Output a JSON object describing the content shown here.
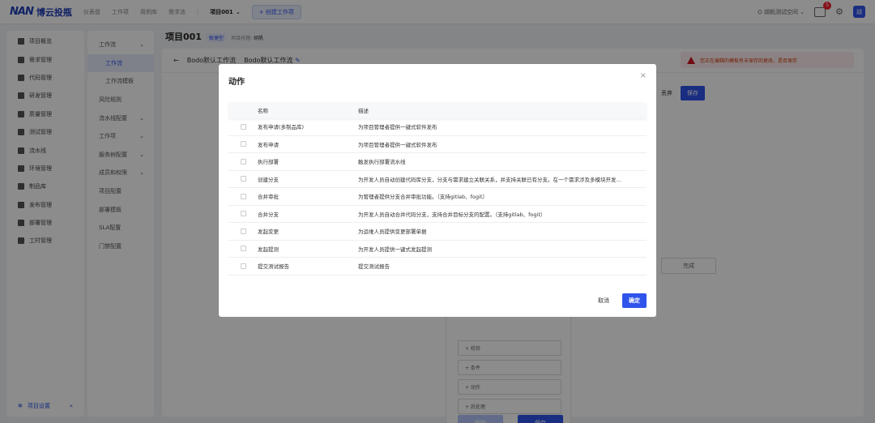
{
  "header": {
    "logo_mark": "NAN",
    "logo_text": "博云投瓶",
    "nav": [
      "仪表盘",
      "工作项",
      "用例库",
      "需求池"
    ],
    "project_select": "项目001",
    "create_button": "+ 创建工作项",
    "workspace": "胡帆测试空间",
    "notif_count": "5",
    "avatar": "胡"
  },
  "sidebar": {
    "items": [
      {
        "label": "项目概览",
        "icon": "home-icon"
      },
      {
        "label": "需求管理",
        "icon": "grid-icon"
      },
      {
        "label": "代码管理",
        "icon": "code-icon"
      },
      {
        "label": "研发管理",
        "icon": "dev-icon"
      },
      {
        "label": "质量管理",
        "icon": "quality-icon"
      },
      {
        "label": "测试管理",
        "icon": "test-icon"
      },
      {
        "label": "流水线",
        "icon": "pipeline-icon"
      },
      {
        "label": "环境管理",
        "icon": "env-icon"
      },
      {
        "label": "制品库",
        "icon": "artifact-icon"
      },
      {
        "label": "发布管理",
        "icon": "release-icon"
      },
      {
        "label": "部署管理",
        "icon": "deploy-icon"
      },
      {
        "label": "工时管理",
        "icon": "timesheet-icon"
      }
    ],
    "footer_label": "项目设置",
    "collapse": "«"
  },
  "subnav": {
    "items": [
      {
        "label": "工作流",
        "chev": "⌄",
        "kind": "group"
      },
      {
        "label": "工作流",
        "chev": "",
        "kind": "active"
      },
      {
        "label": "工作流模板",
        "chev": "",
        "kind": "child"
      },
      {
        "label": "风险规则",
        "chev": "",
        "kind": "group"
      },
      {
        "label": "流水线配置",
        "chev": "⌄",
        "kind": "group"
      },
      {
        "label": "工作项",
        "chev": "⌄",
        "kind": "group"
      },
      {
        "label": "服务树配置",
        "chev": "⌄",
        "kind": "group"
      },
      {
        "label": "成员和权限",
        "chev": "⌄",
        "kind": "group"
      },
      {
        "label": "项目配置",
        "chev": "",
        "kind": "group"
      },
      {
        "label": "部署模板",
        "chev": "",
        "kind": "group"
      },
      {
        "label": "SLA配置",
        "chev": "",
        "kind": "group"
      },
      {
        "label": "门禁配置",
        "chev": "",
        "kind": "group"
      }
    ]
  },
  "main": {
    "project_name": "项目001",
    "tag": "敏捷型",
    "manager_label": "项目经理:",
    "manager_name": "胡帆",
    "back_title": "Bodo默认工作流",
    "tab_title": "Bodo默认工作流",
    "warning": "您正在编辑的模板有未保存的更改，是否保存",
    "discard": "丢弃",
    "save": "保存",
    "done_node": "完成",
    "side_rows": [
      "+ 校验",
      "+ 条件",
      "+ 动作",
      "+ 后处理"
    ],
    "delete_btn": "删除",
    "save_btn": "保存"
  },
  "modal": {
    "title": "动作",
    "close": "×",
    "columns": {
      "name": "名称",
      "desc": "描述"
    },
    "rows": [
      {
        "name": "发布申请(多制品库)",
        "desc": "为项目管理者提供一键式软件发布"
      },
      {
        "name": "发布申请",
        "desc": "为项目管理者提供一键式软件发布"
      },
      {
        "name": "执行部署",
        "desc": "触发执行部署流水线"
      },
      {
        "name": "创建分支",
        "desc": "为开发人员自动创建代码库分支，分支与需求建立关联关系，并支持关联已有分支。在一个需求涉及多模块开发…"
      },
      {
        "name": "合并审批",
        "desc": "为管理者提供分支合并审批功能。（支持gitlab、fogit）"
      },
      {
        "name": "合并分支",
        "desc": "为开发人员自动合并代码分支，支持合并目标分支的配置。（支持gitlab、fogit）"
      },
      {
        "name": "发起变更",
        "desc": "为运维人员提供变更部署单据"
      },
      {
        "name": "发起提测",
        "desc": "为开发人员提供一键式发起提测"
      },
      {
        "name": "提交测试报告",
        "desc": "提交测试报告"
      }
    ],
    "cancel": "取消",
    "ok": "确定"
  }
}
